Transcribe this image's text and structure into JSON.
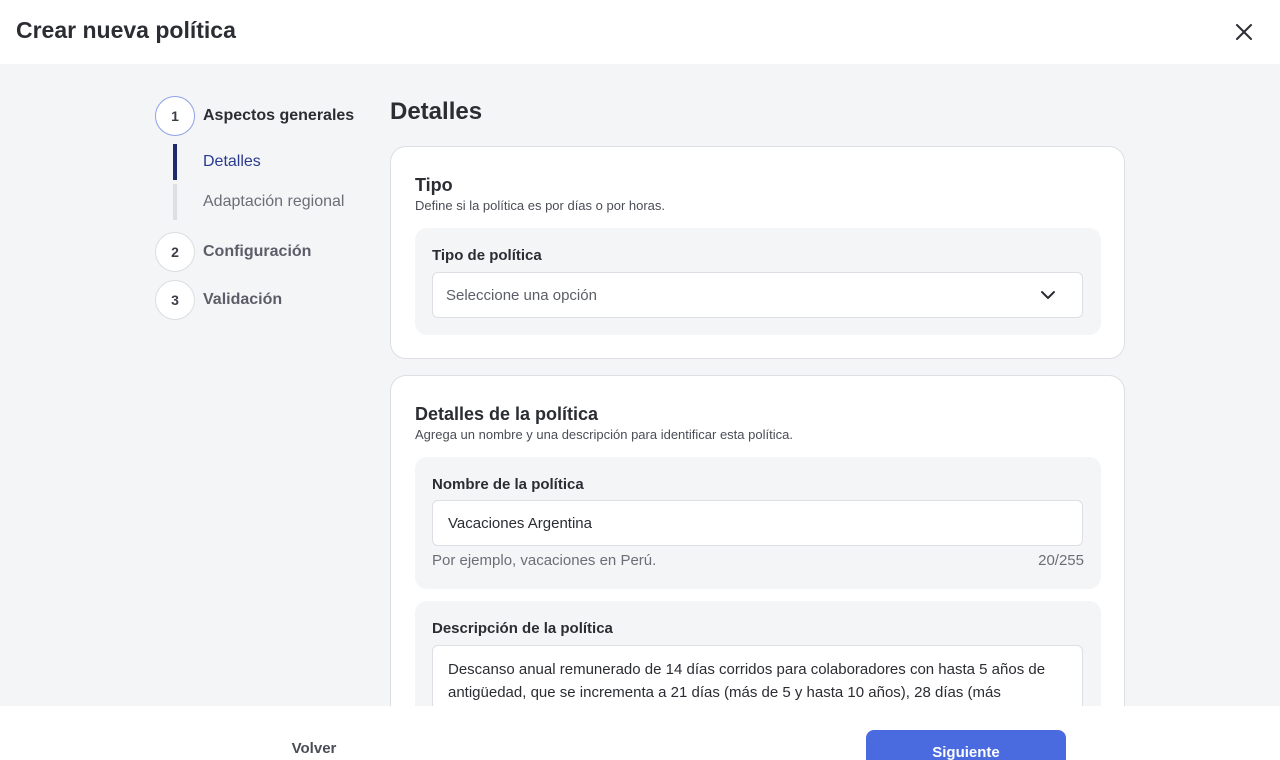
{
  "header": {
    "title": "Crear nueva política"
  },
  "stepper": {
    "steps": [
      {
        "number": "1",
        "label": "Aspectos generales"
      },
      {
        "number": "2",
        "label": "Configuración"
      },
      {
        "number": "3",
        "label": "Validación"
      }
    ],
    "substeps": [
      {
        "label": "Detalles"
      },
      {
        "label": "Adaptación regional"
      }
    ]
  },
  "main": {
    "title": "Detalles",
    "tipo_card": {
      "title": "Tipo",
      "subtitle": "Define si la política es por días o por horas.",
      "field_label": "Tipo de política",
      "select_placeholder": "Seleccione una opción"
    },
    "details_card": {
      "title": "Detalles de la política",
      "subtitle": "Agrega un nombre y una descripción para identificar esta política.",
      "name_label": "Nombre de la política",
      "name_value": "Vacaciones Argentina",
      "name_hint": "Por ejemplo, vacaciones en Perú.",
      "name_counter": "20/255",
      "description_label": "Descripción de la política",
      "description_value": "Descanso anual remunerado de 14 días corridos para colaboradores con hasta 5 años de antigüedad, que se incrementa a 21 días (más de 5 y hasta 10 años), 28 días (más"
    }
  },
  "footer": {
    "back_label": "Volver",
    "next_label": "Siguiente"
  },
  "colors": {
    "primary": "#4a6be0",
    "active_bar": "#1f2a6b",
    "background": "#f4f5f7"
  }
}
